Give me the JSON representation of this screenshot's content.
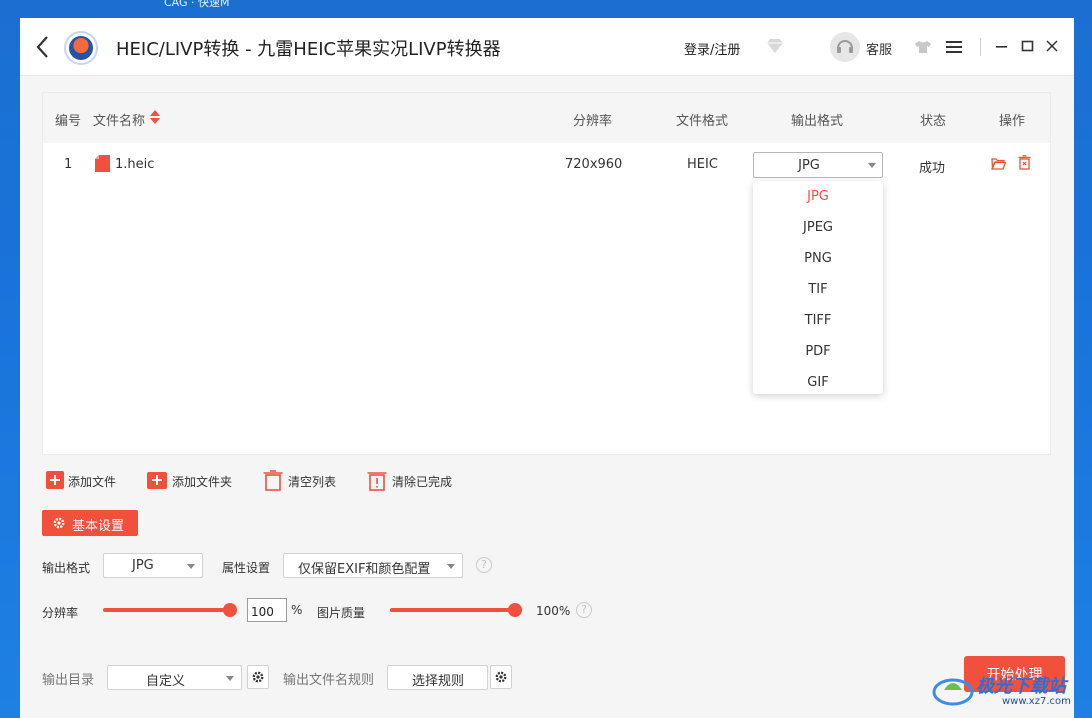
{
  "desktop": {
    "top_text": "CAG   ·  快速M"
  },
  "titlebar": {
    "title": "HEIC/LIVP转换 - 九雷HEIC苹果实况LIVP转换器",
    "login": "登录/注册",
    "customer_service": "客服"
  },
  "table": {
    "headers": {
      "no": "编号",
      "name": "文件名称",
      "resolution": "分辨率",
      "format": "文件格式",
      "output": "输出格式",
      "status": "状态",
      "actions": "操作"
    },
    "rows": [
      {
        "no": "1",
        "name": "1.heic",
        "resolution": "720x960",
        "format": "HEIC",
        "output": "JPG",
        "status": "成功"
      }
    ]
  },
  "format_dropdown": {
    "selected": "JPG",
    "options": [
      "JPG",
      "JPEG",
      "PNG",
      "TIF",
      "TIFF",
      "PDF",
      "GIF"
    ]
  },
  "toolbar": {
    "add_file": "添加文件",
    "add_folder": "添加文件夹",
    "clear_list": "清空列表",
    "clear_done": "清除已完成"
  },
  "settings": {
    "title": "基本设置",
    "output_format_label": "输出格式",
    "output_format_value": "JPG",
    "attribute_label": "属性设置",
    "attribute_value": "仅保留EXIF和颜色配置",
    "help": "?",
    "resolution_label": "分辨率",
    "resolution_value": "100",
    "resolution_unit": "%",
    "resolution_level": 1.0,
    "quality_label": "图片质量",
    "quality_value": "100%",
    "quality_level": 1.0
  },
  "output": {
    "dir_label": "输出目录",
    "dir_value": "自定义",
    "name_rule_label": "输出文件名规则",
    "rule_button": "选择规则",
    "start_button": "开始处理"
  },
  "watermark": {
    "text": "极光下载站",
    "sub": "www.xz7.com"
  },
  "colors": {
    "accent": "#f0503c",
    "desktop": "#1a73da"
  }
}
